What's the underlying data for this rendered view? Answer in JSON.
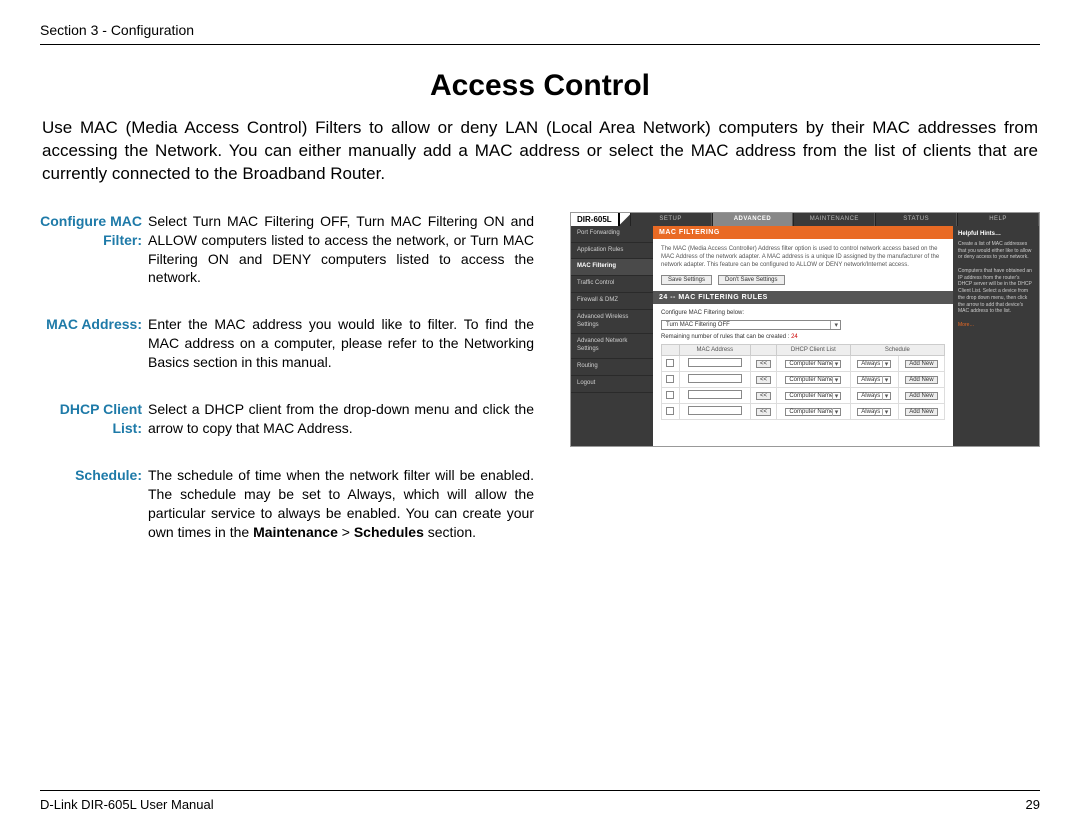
{
  "header": {
    "text": "Section 3 - Configuration"
  },
  "title": "Access Control",
  "intro": "Use MAC (Media Access Control) Filters to allow or deny LAN (Local Area Network) computers by their MAC addresses from accessing the Network. You can either manually add a MAC address or select the MAC address from the list of clients that are currently connected to the Broadband Router.",
  "definitions": [
    {
      "term": "Configure MAC Filter:",
      "desc_plain": "Select Turn MAC Filtering OFF, Turn MAC Filtering ON and ALLOW computers listed to access the network, or Turn MAC Filtering ON and DENY computers listed to access the network."
    },
    {
      "term": "MAC Address:",
      "desc_plain": "Enter the MAC address you would like to filter. To find the MAC address on a computer, please refer to the Networking Basics section in this manual."
    },
    {
      "term": "DHCP Client List:",
      "desc_plain": "Select a DHCP client from the drop-down menu and click the arrow to copy that MAC Address."
    },
    {
      "term": "Schedule:",
      "desc_pre": "The schedule of time when the network filter will be enabled. The schedule may be set to Always, which will allow the particular service to always be enabled. You can create your own times in the ",
      "b1": "Maintenance",
      "mid": " > ",
      "b2": "Schedules",
      "desc_post": " section."
    }
  ],
  "router": {
    "model": "DIR-605L",
    "tabs": [
      "SETUP",
      "ADVANCED",
      "MAINTENANCE",
      "STATUS",
      "HELP"
    ],
    "active_tab": 1,
    "sidebar": [
      "Port Forwarding",
      "Application Rules",
      "MAC Filtering",
      "Traffic Control",
      "Firewall & DMZ",
      "Advanced Wireless Settings",
      "Advanced Network Settings",
      "Routing",
      "Logout"
    ],
    "sidebar_active": 2,
    "section_bar": "MAC FILTERING",
    "section_text": "The MAC (Media Access Controller) Address filter option is used to control network access based on the MAC Address of the network adapter. A MAC address is a unique ID assigned by the manufacturer of the network adapter. This feature can be configured to ALLOW or DENY network/Internet access.",
    "buttons": {
      "save": "Save Settings",
      "dont": "Don't Save Settings"
    },
    "rules_bar": "24 -- MAC FILTERING RULES",
    "rules_intro": "Configure MAC Filtering below:",
    "filter_select": "Turn MAC Filtering OFF",
    "remaining_pre": "Remaining number of rules that can be created : ",
    "remaining_num": "24",
    "table": {
      "headers": [
        "",
        "MAC Address",
        "",
        "DHCP Client List",
        "Schedule",
        ""
      ],
      "client_placeholder": "Computer Name",
      "schedule_placeholder": "Always",
      "add": "Add New",
      "arrow": "<<",
      "rows": 4
    },
    "hints": {
      "title": "Helpful Hints…",
      "p1": "Create a list of MAC addresses that you would either like to allow or deny access to your network.",
      "p2": "Computers that have obtained an IP address from the router's DHCP server will be in the DHCP Client List. Select a device from the drop down menu, then click the arrow to add that device's MAC address to the list.",
      "more": "More…"
    }
  },
  "footer": {
    "left": "D-Link DIR-605L User Manual",
    "right": "29"
  }
}
